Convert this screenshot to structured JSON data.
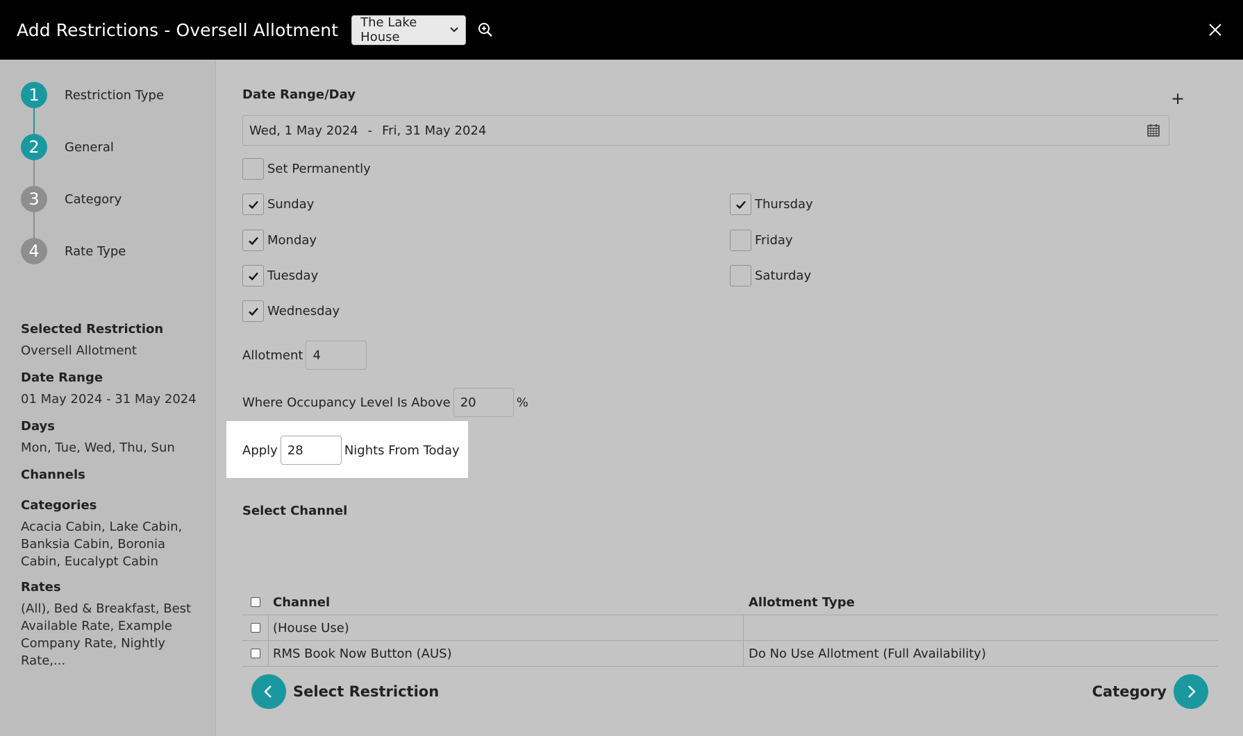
{
  "header": {
    "title": "Add Restrictions - Oversell Allotment",
    "property_selected": "The Lake House"
  },
  "steps": [
    {
      "number": "1",
      "label": "Restriction Type",
      "state": "active"
    },
    {
      "number": "2",
      "label": "General",
      "state": "active"
    },
    {
      "number": "3",
      "label": "Category",
      "state": "inactive"
    },
    {
      "number": "4",
      "label": "Rate Type",
      "state": "inactive"
    }
  ],
  "summary": {
    "selected_restriction_label": "Selected Restriction",
    "selected_restriction_value": "Oversell Allotment",
    "date_range_label": "Date Range",
    "date_range_value": "01 May 2024 - 31 May 2024",
    "days_label": "Days",
    "days_value": "Mon, Tue, Wed, Thu, Sun",
    "channels_label": "Channels",
    "categories_label": "Categories",
    "categories_value": "Acacia Cabin, Lake Cabin, Banksia Cabin, Boronia Cabin, Eucalypt Cabin",
    "rates_label": "Rates",
    "rates_value": "(All), Bed & Breakfast, Best Available Rate, Example Company Rate, Nightly Rate,..."
  },
  "main": {
    "date_section_title": "Date Range/Day",
    "add_label": "+",
    "date_start": "Wed, 1 May 2024",
    "date_separator": "-",
    "date_end": "Fri, 31 May 2024",
    "set_permanently_label": "Set Permanently",
    "days": {
      "sunday": "Sunday",
      "monday": "Monday",
      "tuesday": "Tuesday",
      "wednesday": "Wednesday",
      "thursday": "Thursday",
      "friday": "Friday",
      "saturday": "Saturday"
    },
    "allotment_label": "Allotment",
    "allotment_value": "4",
    "occupancy_label": "Where Occupancy Level Is Above",
    "occupancy_value": "20",
    "occupancy_unit": "%",
    "apply_label": "Apply",
    "apply_value": "28",
    "apply_suffix": "Nights From Today",
    "channel_section_title": "Select Channel",
    "table": {
      "col_channel": "Channel",
      "col_allotment_type": "Allotment Type",
      "rows": [
        {
          "channel": "(House Use)",
          "allotment_type": ""
        },
        {
          "channel": "RMS Book Now Button (AUS)",
          "allotment_type": "Do No Use Allotment (Full Availability)"
        }
      ]
    }
  },
  "footer": {
    "back_label": "Select Restriction",
    "next_label": "Category"
  },
  "colors": {
    "accent": "#1a98a0",
    "header_bg": "#000000",
    "step_inactive": "#8e8e8e"
  }
}
